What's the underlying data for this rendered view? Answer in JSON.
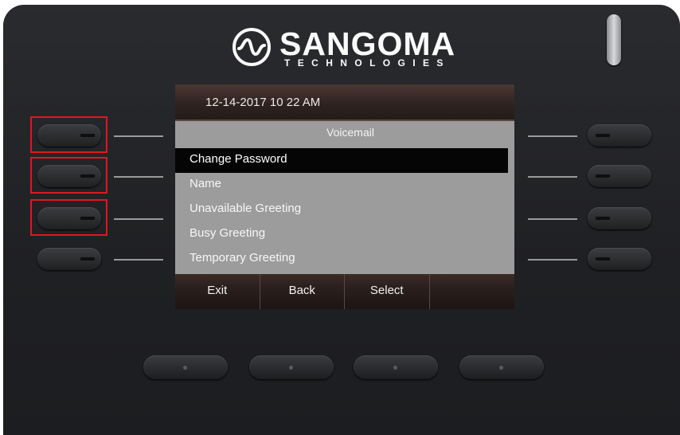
{
  "logo": {
    "brand": "SANGOMA",
    "sub": "TECHNOLOGIES"
  },
  "screen": {
    "datetime": "12-14-2017 10 22 AM",
    "title": "Voicemail",
    "menu_items": [
      {
        "label": "Change Password",
        "selected": true
      },
      {
        "label": "Name",
        "selected": false
      },
      {
        "label": "Unavailable Greeting",
        "selected": false
      },
      {
        "label": "Busy Greeting",
        "selected": false
      },
      {
        "label": "Temporary Greeting",
        "selected": false
      }
    ],
    "softkeys": [
      "Exit",
      "Back",
      "Select",
      ""
    ]
  },
  "colors": {
    "highlight_box": "#e0171f",
    "selected_row": "#050505",
    "screen_bg": "#9c9c9c"
  }
}
